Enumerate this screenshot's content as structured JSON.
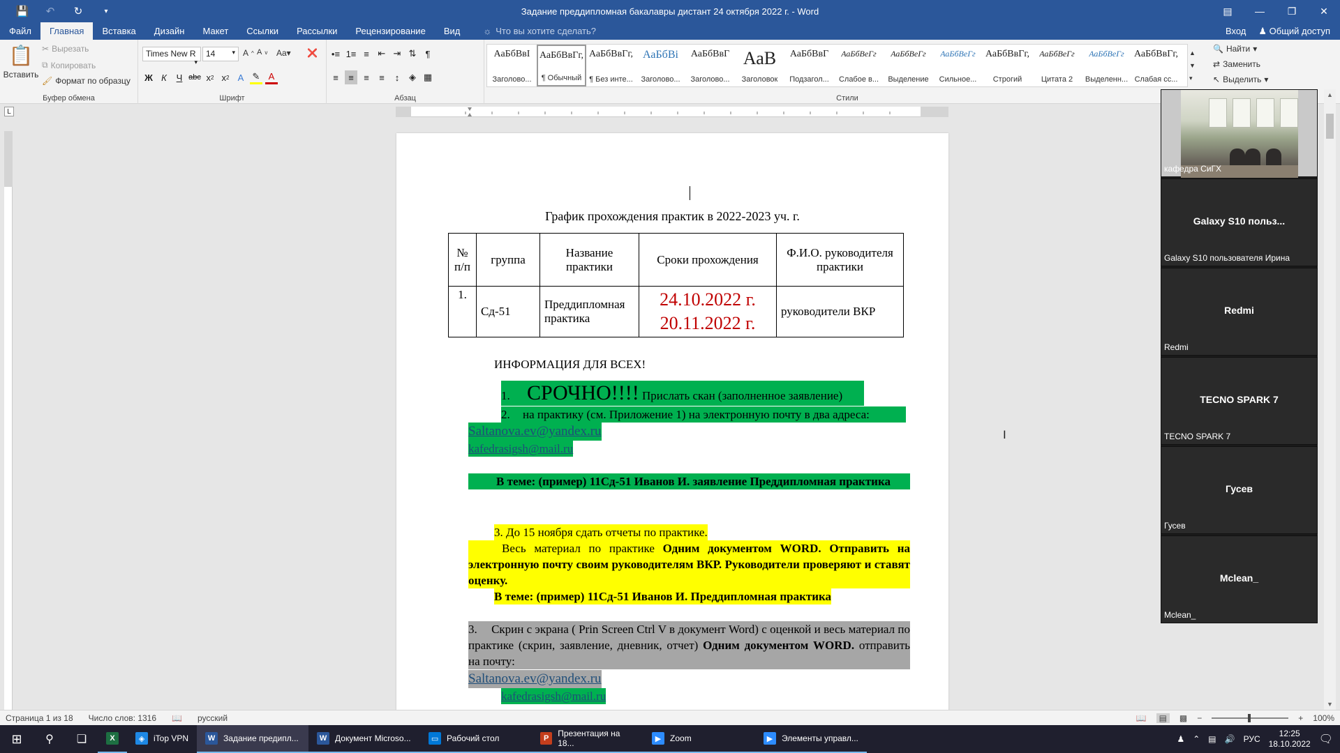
{
  "titlebar": {
    "title": "Задание преддипломная бакалавры дистант  24 октября 2022 г. - Word",
    "qat": [
      "save-icon",
      "undo-icon",
      "redo-icon",
      "customize-icon"
    ]
  },
  "tabs": {
    "items": [
      "Файл",
      "Главная",
      "Вставка",
      "Дизайн",
      "Макет",
      "Ссылки",
      "Рассылки",
      "Рецензирование",
      "Вид"
    ],
    "active": "Главная",
    "tell_me": "Что вы хотите сделать?",
    "signin": "Вход",
    "share": "Общий доступ"
  },
  "ribbon": {
    "clipboard": {
      "label": "Буфер обмена",
      "paste": "Вставить",
      "cut": "Вырезать",
      "copy": "Копировать",
      "format_painter": "Формат по образцу"
    },
    "font": {
      "label": "Шрифт",
      "name": "Times New R",
      "size": "14"
    },
    "paragraph": {
      "label": "Абзац"
    },
    "styles": {
      "label": "Стили",
      "items": [
        {
          "preview": "АаБбВвІ",
          "name": "Заголово..."
        },
        {
          "preview": "АаБбВвГг,",
          "name": "¶ Обычный"
        },
        {
          "preview": "АаБбВвГг,",
          "name": "¶ Без инте..."
        },
        {
          "preview": "АаБбВі",
          "name": "Заголово..."
        },
        {
          "preview": "АаБбВвГ",
          "name": "Заголово..."
        },
        {
          "preview": "АаВ",
          "name": "Заголовок"
        },
        {
          "preview": "АаБбВвГ",
          "name": "Подзагол..."
        },
        {
          "preview": "АаБбВеГг",
          "name": "Слабое в..."
        },
        {
          "preview": "АаБбВеГг",
          "name": "Выделение"
        },
        {
          "preview": "АаБбВеГг",
          "name": "Сильное..."
        },
        {
          "preview": "АаБбВвГг,",
          "name": "Строгий"
        },
        {
          "preview": "АаБбВеГг",
          "name": "Цитата 2"
        },
        {
          "preview": "АаБбВеГг",
          "name": "Выделенн..."
        },
        {
          "preview": "АаБбВвГг,",
          "name": "Слабая сс..."
        }
      ],
      "selected_index": 1
    },
    "editing": {
      "find": "Найти",
      "replace": "Заменить",
      "select": "Выделить"
    }
  },
  "document": {
    "title": "График прохождения практик   в 2022-2023  уч. г.",
    "table": {
      "headers": [
        "№ п/п",
        "группа",
        "Название практики",
        "Сроки прохождения",
        "Ф.И.О. руководителя практики"
      ],
      "rows": [
        {
          "num": "1.",
          "group": "Сд-51",
          "name": "Преддипломная практика",
          "date1": "24.10.2022 г.",
          "date2": "20.11.2022 г.",
          "lead": "руководители ВКР"
        }
      ]
    },
    "info_heading": "ИНФОРМАЦИЯ ДЛЯ ВСЕХ!",
    "p1_num": "1.",
    "p1_urgent": "СРОЧНО!!!!",
    "p1_text": "Прислать скан (заполненное заявление)",
    "p2_num": "2.",
    "p2_text": "на практику (см. Приложение 1) на электронную почту в два адреса:",
    "email1": "Saltanova.ev@yandex.ru",
    "email2": "kafedrasigsh@mail.ru",
    "subject_example": "В теме: (пример)  11Сд-51 Иванов И. заявление Преддипломная практика",
    "p3_heading": "3.  До 15 ноября сдать отчеты по практике.",
    "p3_text_a": "Весь материал по практике ",
    "p3_text_b": "Одним документом WORD. Отправить на электронную почту  своим руководителям ВКР. Руководители проверяют и ставят оценку.",
    "p3_subject": "В теме: (пример)  11Сд-51 Иванов И. Преддипломная практика",
    "p4_num": "3.",
    "p4_text_a": "Скрин с экрана ( Prin Screen  Ctrl V в документ Word)  с оценкой и весь материал по практике (скрин, заявление, дневник, отчет) ",
    "p4_text_b": "Одним документом WORD.",
    "p4_text_c": " отправить на почту:",
    "email3": "Saltanova.ev@yandex.ru",
    "email4": "kafedrasigsh@mail.ru"
  },
  "participants": [
    {
      "label": "кафедра СиГХ",
      "video": true
    },
    {
      "name": "Galaxy S10 польз...",
      "label": "Galaxy S10 пользователя Ирина"
    },
    {
      "name": "Redmi",
      "label": "Redmi"
    },
    {
      "name": "TECNO SPARK 7",
      "label": "TECNO SPARK 7"
    },
    {
      "name": "Гусев",
      "label": "Гусев"
    },
    {
      "name": "Mclean_",
      "label": "Mclean_"
    }
  ],
  "statusbar": {
    "page": "Страница 1 из 18",
    "words": "Число слов: 1316",
    "language": "русский",
    "zoom": "100%"
  },
  "taskbar": {
    "apps": [
      {
        "label": "",
        "icon": "excel-icon",
        "color": "#1d6f42",
        "glyph": "X"
      },
      {
        "label": "iTop VPN",
        "icon": "vpn-icon",
        "color": "#1e88e5",
        "glyph": "◈"
      },
      {
        "label": "Задание предипл...",
        "icon": "word-icon",
        "color": "#2b579a",
        "glyph": "W",
        "active": true
      },
      {
        "label": "Документ Microso...",
        "icon": "word-icon",
        "color": "#2b579a",
        "glyph": "W"
      },
      {
        "label": "Рабочий стол",
        "icon": "desktop-icon",
        "color": "#0078d7",
        "glyph": "▭"
      },
      {
        "label": "Презентация на 18...",
        "icon": "powerpoint-icon",
        "color": "#c43e1c",
        "glyph": "P"
      },
      {
        "label": "Zoom",
        "icon": "zoom-icon",
        "color": "#2d8cff",
        "glyph": "▶"
      },
      {
        "label": "Элементы управл...",
        "icon": "zoom-controls-icon",
        "color": "#2d8cff",
        "glyph": "▶"
      }
    ],
    "lang": "РУС",
    "time": "12:25",
    "date": "18.10.2022"
  }
}
